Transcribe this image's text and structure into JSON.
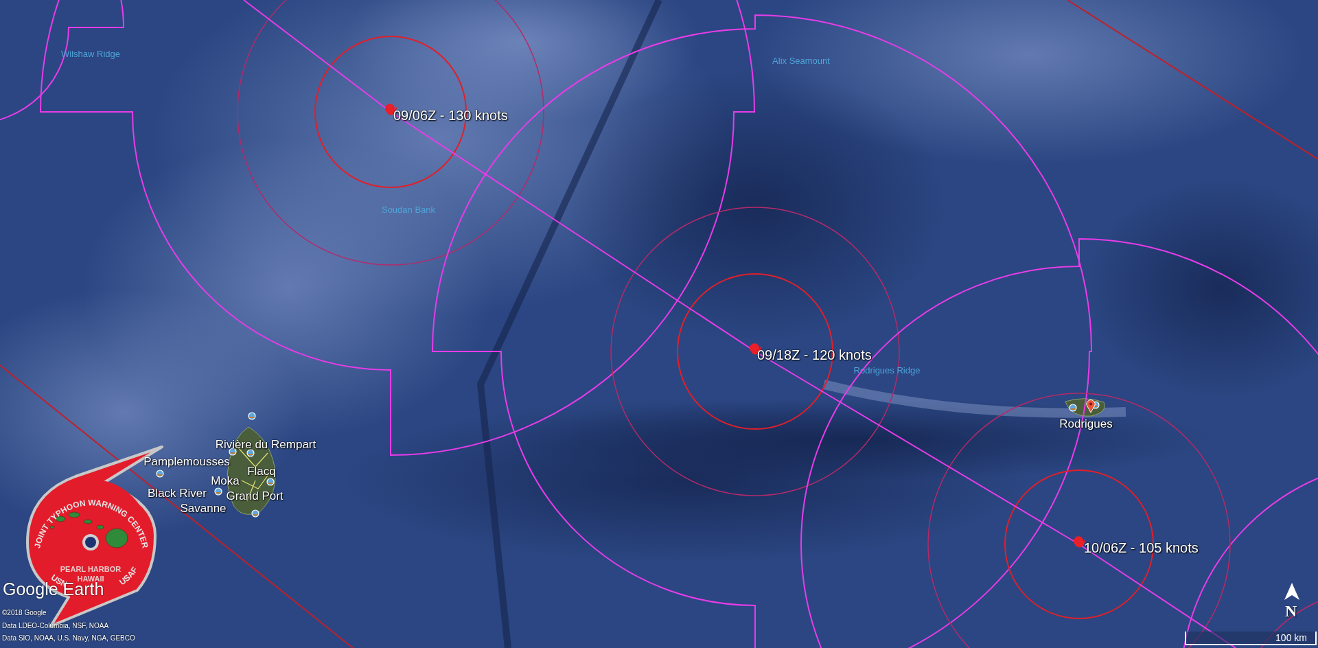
{
  "map": {
    "storm_fixes": [
      {
        "label": "09/06Z - 130 knots"
      },
      {
        "label": "09/18Z - 120 knots"
      },
      {
        "label": "10/06Z - 105 knots"
      }
    ],
    "places": [
      {
        "name": "Wilshaw Ridge",
        "kind": "undersea"
      },
      {
        "name": "Alix Seamount",
        "kind": "undersea"
      },
      {
        "name": "Soudan Bank",
        "kind": "undersea"
      },
      {
        "name": "Rodrigues Ridge",
        "kind": "undersea"
      },
      {
        "name": "Rivière du Rempart",
        "kind": "town"
      },
      {
        "name": "Pamplemousses",
        "kind": "town"
      },
      {
        "name": "Flacq",
        "kind": "town"
      },
      {
        "name": "Moka",
        "kind": "town"
      },
      {
        "name": "Black River",
        "kind": "town"
      },
      {
        "name": "Grand Port",
        "kind": "town"
      },
      {
        "name": "Savanne",
        "kind": "town"
      },
      {
        "name": "Rodrigues",
        "kind": "town"
      }
    ]
  },
  "emblem": {
    "ring_text": "JOINT TYPHOON WARNING CENTER",
    "left_text": "USN",
    "right_text": "USAF",
    "lines": [
      "PEARL HARBOR",
      "HAWAII"
    ]
  },
  "brand": "Google Earth",
  "attribution": [
    "©2018 Google",
    "Data LDEO-Columbia, NSF, NOAA",
    "Data SIO, NOAA, U.S. Navy, NGA, GEBCO"
  ],
  "scale_bar": {
    "label": "100 km"
  },
  "compass": {
    "label": "N"
  }
}
